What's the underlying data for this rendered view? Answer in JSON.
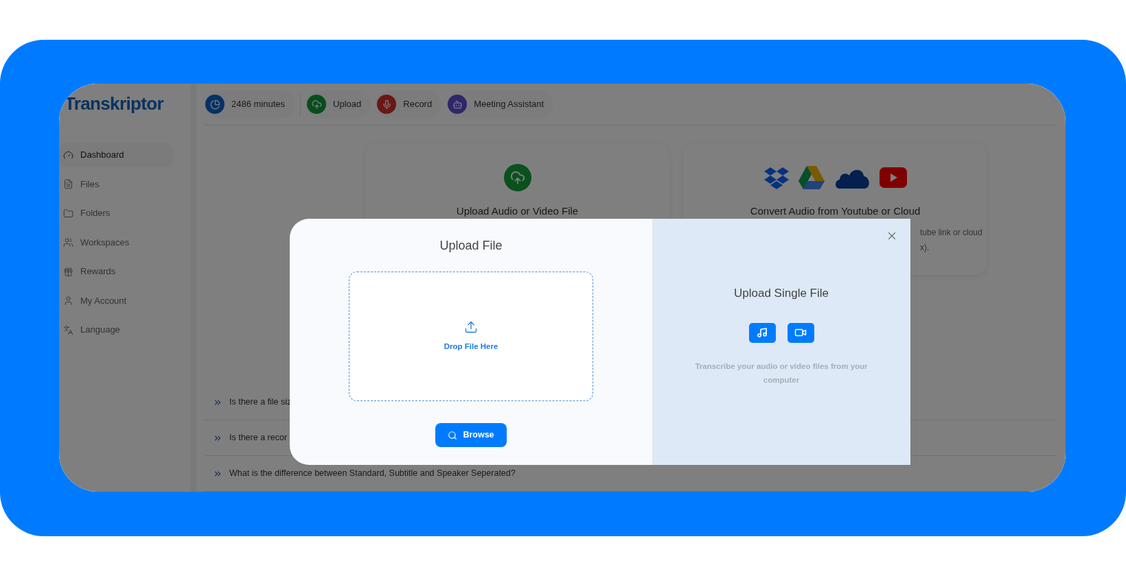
{
  "logo": {
    "text": "Transkriptor"
  },
  "header_items": [
    {
      "label": "2486 minutes",
      "kind": "minutes"
    },
    {
      "label": "Upload",
      "kind": "upload"
    },
    {
      "label": "Record",
      "kind": "record"
    },
    {
      "label": "Meeting Assistant",
      "kind": "assistant"
    }
  ],
  "sidebar": {
    "items": [
      {
        "label": "Dashboard",
        "kind": "dashboard",
        "selected": true
      },
      {
        "label": "Files",
        "kind": "files",
        "selected": false
      },
      {
        "label": "Folders",
        "kind": "folders",
        "selected": false
      },
      {
        "label": "Workspaces",
        "kind": "workspaces",
        "selected": false
      },
      {
        "label": "Rewards",
        "kind": "rewards",
        "selected": false
      },
      {
        "label": "My Account",
        "kind": "account",
        "selected": false
      },
      {
        "label": "Language",
        "kind": "language",
        "selected": false
      }
    ]
  },
  "cards": [
    {
      "kind": "upload",
      "title": "Upload Audio or Video File"
    },
    {
      "kind": "cloud",
      "title": "Convert Audio from Youtube or Cloud",
      "description_lines": [
        "tube link or cloud",
        "x)."
      ]
    }
  ],
  "faq": [
    "Is there a file siz",
    "Is there a recor",
    "What is the difference between Standard, Subtitle and Speaker Seperated?"
  ],
  "modal": {
    "title": "Upload File",
    "dropzone": {
      "label": "Drop File Here"
    },
    "browse_button": "Browse",
    "side": {
      "title": "Upload Single File",
      "description": "Transcribe your audio or video files from your computer"
    }
  }
}
